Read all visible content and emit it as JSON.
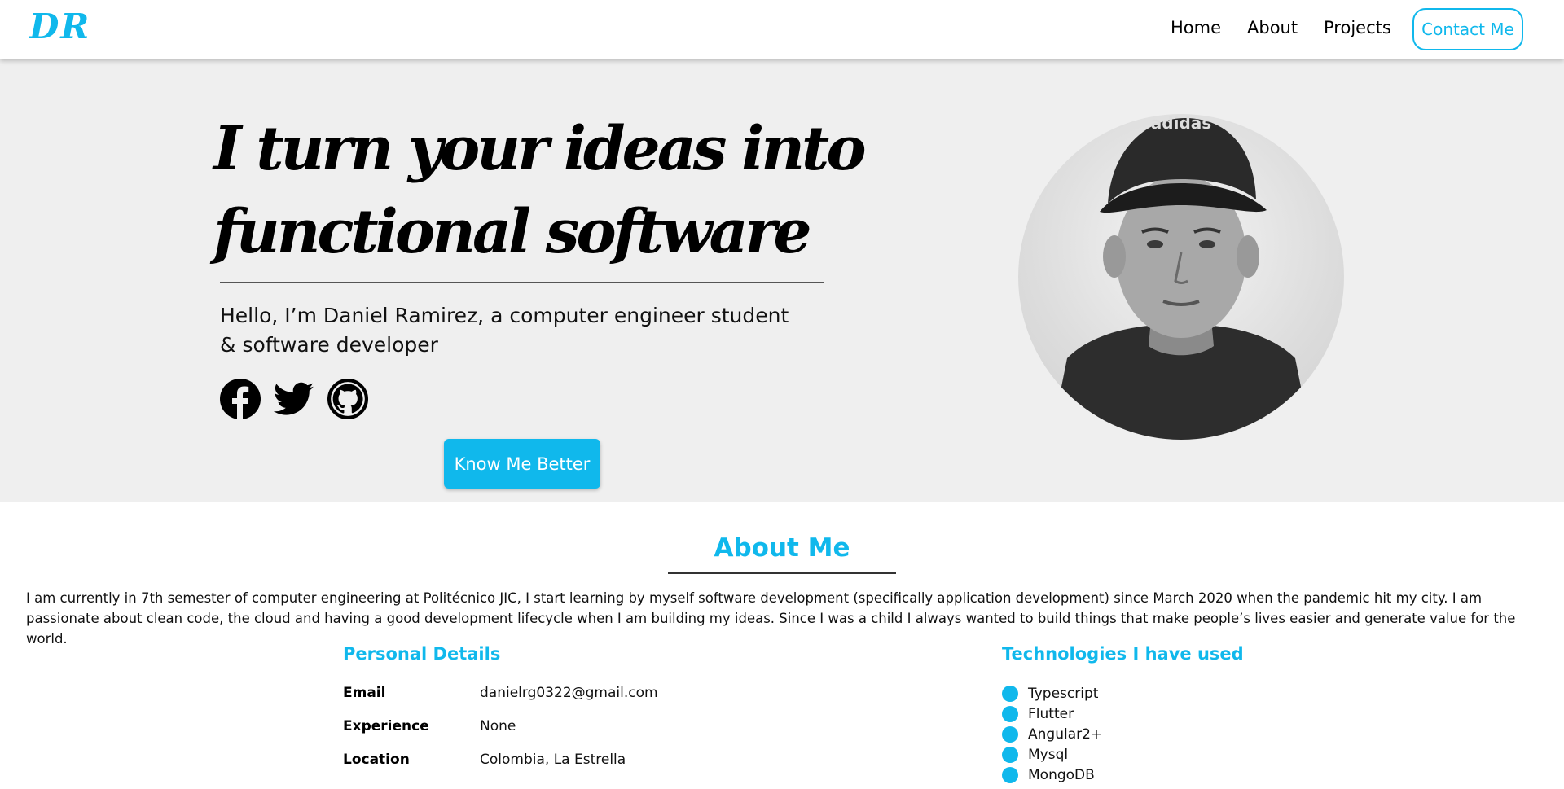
{
  "brand": {
    "logo": "DR",
    "accent": "#10b8ec"
  },
  "nav": {
    "home": "Home",
    "about": "About",
    "projects": "Projects",
    "contact": "Contact Me"
  },
  "hero": {
    "title_line1": "I turn your ideas into",
    "title_line2": "functional software",
    "subtitle": "Hello, I’m Daniel Ramirez, a computer engineer student & software developer",
    "cta": "Know Me Better",
    "socials": [
      "facebook-icon",
      "twitter-icon",
      "github-icon"
    ],
    "avatar_text": "adidas"
  },
  "about": {
    "title": "About Me",
    "text": "I am currently in 7th semester of computer engineering at Politécnico JIC, I start learning by myself software development (specifically application development) since March 2020 when the pandemic hit my city. I am passionate about clean code, the cloud and having a good development lifecycle when I am building my ideas. Since I was a child I always wanted to build things that make people’s lives easier and generate value for the world."
  },
  "personal": {
    "title": "Personal Details",
    "rows": [
      {
        "label": "Email",
        "value": "danielrg0322@gmail.com"
      },
      {
        "label": "Experience",
        "value": "None"
      },
      {
        "label": "Location",
        "value": "Colombia, La Estrella"
      }
    ]
  },
  "technologies": {
    "title": "Technologies I have used",
    "items": [
      "Typescript",
      "Flutter",
      "Angular2+",
      "Mysql",
      "MongoDB"
    ]
  }
}
